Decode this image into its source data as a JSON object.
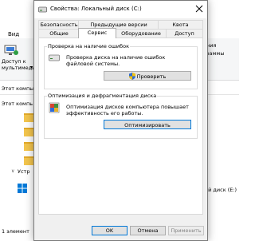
{
  "explorer": {
    "tab_view": "Вид",
    "access_label": "Доступ к\nмультимедиа",
    "access_arrow": "▾",
    "right_labels": "ения\nграммы",
    "address_text": "Этот компьют",
    "left_item_1": "Этот компь",
    "left_item_2": "Устр",
    "disk_label": "ый диск (E:)",
    "status_text": "1 элемент"
  },
  "dialog": {
    "title": "Свойства: Локальный диск (C:)",
    "tabs_row1": [
      "Безопасность",
      "Предыдущие версии",
      "Квота"
    ],
    "tabs_row2": [
      "Общие",
      "Сервис",
      "Оборудование",
      "Доступ"
    ],
    "active_tab": "Сервис",
    "check_group": {
      "title": "Проверка на наличие ошибок",
      "text": "Проверка диска на наличие ошибок файловой системы.",
      "button": "Проверить"
    },
    "optimize_group": {
      "title": "Оптимизация и дефрагментация диска",
      "text": "Оптимизация дисков компьютера повышает эффективность его работы.",
      "button": "Оптимизировать"
    },
    "footer": {
      "ok": "OK",
      "cancel": "Отмена",
      "apply": "Применить"
    }
  },
  "colors": {
    "accent": "#0078d7",
    "folder": "#f3c54d",
    "dialog_bg": "#f0f0f0"
  }
}
